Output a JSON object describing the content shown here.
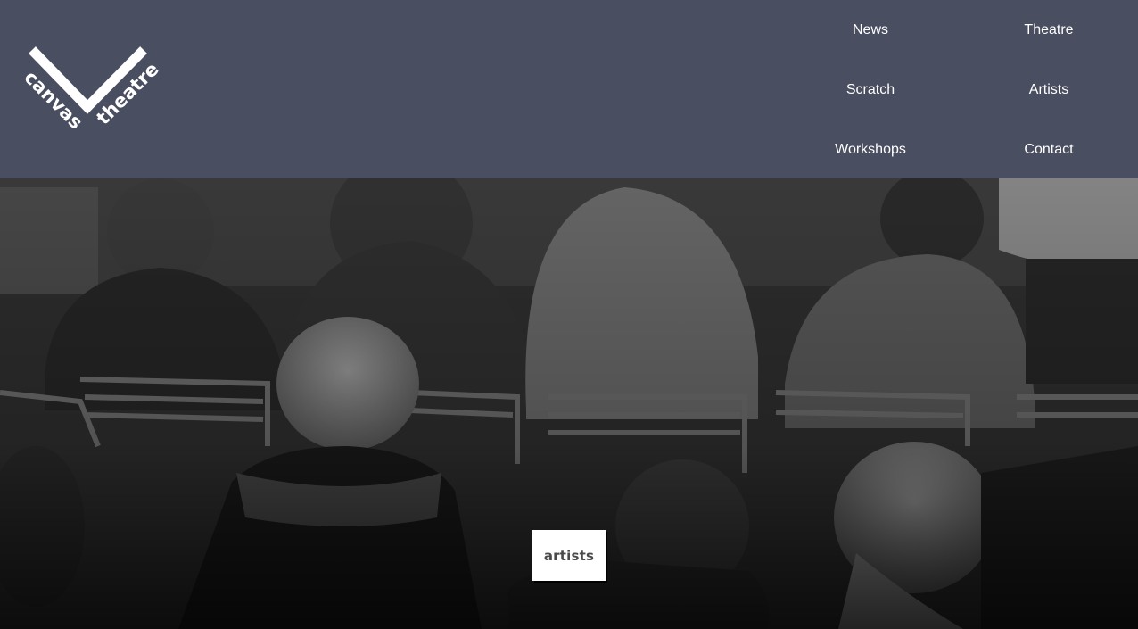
{
  "logo": {
    "word_left": "canvas",
    "word_right": "theatre"
  },
  "nav": {
    "news": "News",
    "theatre": "Theatre",
    "scratch": "Scratch",
    "artists": "Artists",
    "workshops": "Workshops",
    "contact": "Contact"
  },
  "hero": {
    "badge_label": "artists"
  },
  "colors": {
    "header_bg": "#4a4e61",
    "nav_text": "#ffffff",
    "badge_bg": "#ffffff",
    "badge_text": "#4a4a4a"
  }
}
